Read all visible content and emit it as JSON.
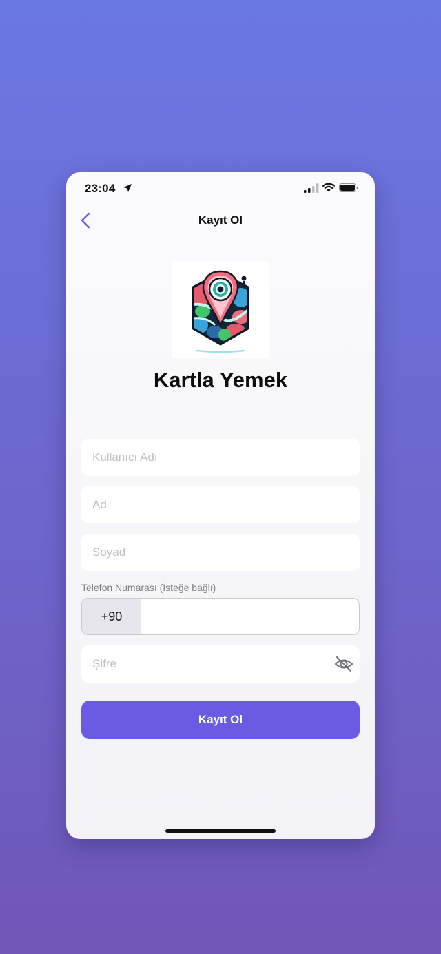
{
  "status_bar": {
    "time": "23:04"
  },
  "nav": {
    "title": "Kayıt Ol"
  },
  "app": {
    "name": "Kartla Yemek"
  },
  "form": {
    "username_placeholder": "Kullanıcı Adı",
    "first_name_placeholder": "Ad",
    "last_name_placeholder": "Soyad",
    "phone_label": "Telefon Numarası (İsteğe bağlı)",
    "country_code": "+90",
    "password_placeholder": "Şifre",
    "submit_label": "Kayıt Ol"
  },
  "icons": {
    "back": "chevron-left-icon",
    "password_toggle": "eye-slash-icon",
    "location": "location-arrow-icon",
    "signal": "cellular-signal-icon",
    "wifi": "wifi-icon",
    "battery": "battery-icon"
  },
  "colors": {
    "accent": "#6b5be3",
    "background_top": "#6a78e2",
    "background_bottom": "#7057b8",
    "back_chevron": "#6b5be3"
  }
}
